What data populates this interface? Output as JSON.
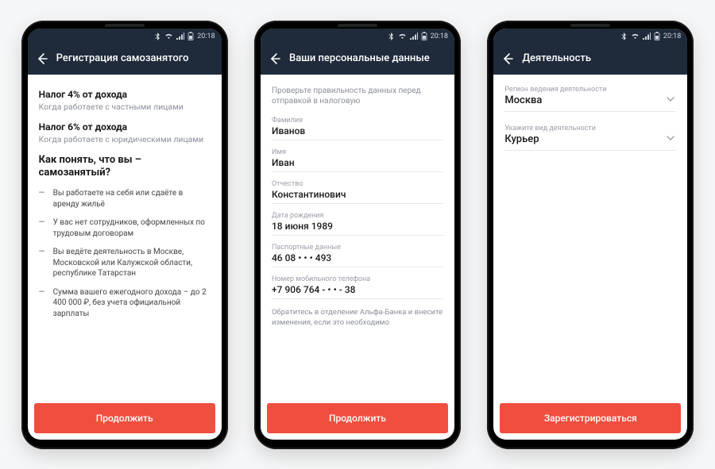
{
  "status": {
    "time": "20:18"
  },
  "screen1": {
    "title": "Регистрация самозанятого",
    "tax4_title": "Налог 4% от дохода",
    "tax4_sub": "Когда работаете с частными лицами",
    "tax6_title": "Налог 6% от дохода",
    "tax6_sub": "Когда работаете с юридическими лицами",
    "question": "Как понять, что вы – самозанятый?",
    "bullets": [
      "Вы работаете на себя или сдаёте в аренду жильё",
      "У вас нет сотрудников, оформленных по трудовым договорам",
      "Вы ведёте деятельность в Москве, Московской или Калужской области, республике Татарстан",
      "Сумма вашего ежегодного дохода – до 2 400 000 ₽, без учета официальной зарплаты"
    ],
    "cta": "Продолжить"
  },
  "screen2": {
    "title": "Ваши персональные данные",
    "instruction": "Проверьте правильность данных перед отправкой в налоговую",
    "fields": {
      "surname_label": "Фамилия",
      "surname_value": "Иванов",
      "name_label": "Имя",
      "name_value": "Иван",
      "patronymic_label": "Отчество",
      "patronymic_value": "Константинович",
      "dob_label": "Дата рождения",
      "dob_value": "18 июня 1989",
      "passport_label": "Паспортные данные",
      "passport_value": "46 08 • • • 493",
      "phone_label": "Номер мобильного телефона",
      "phone_value": "+7 906 764 - • • - 38"
    },
    "note": "Обратитесь в отделение Альфа-Банка и внесите изменения, если это необходимо",
    "cta": "Продолжить"
  },
  "screen3": {
    "title": "Деятельность",
    "region_label": "Регион ведения деятельности",
    "region_value": "Москва",
    "activity_label": "Укажите вид деятельности",
    "activity_value": "Курьер",
    "cta": "Зарегистрироваться"
  }
}
